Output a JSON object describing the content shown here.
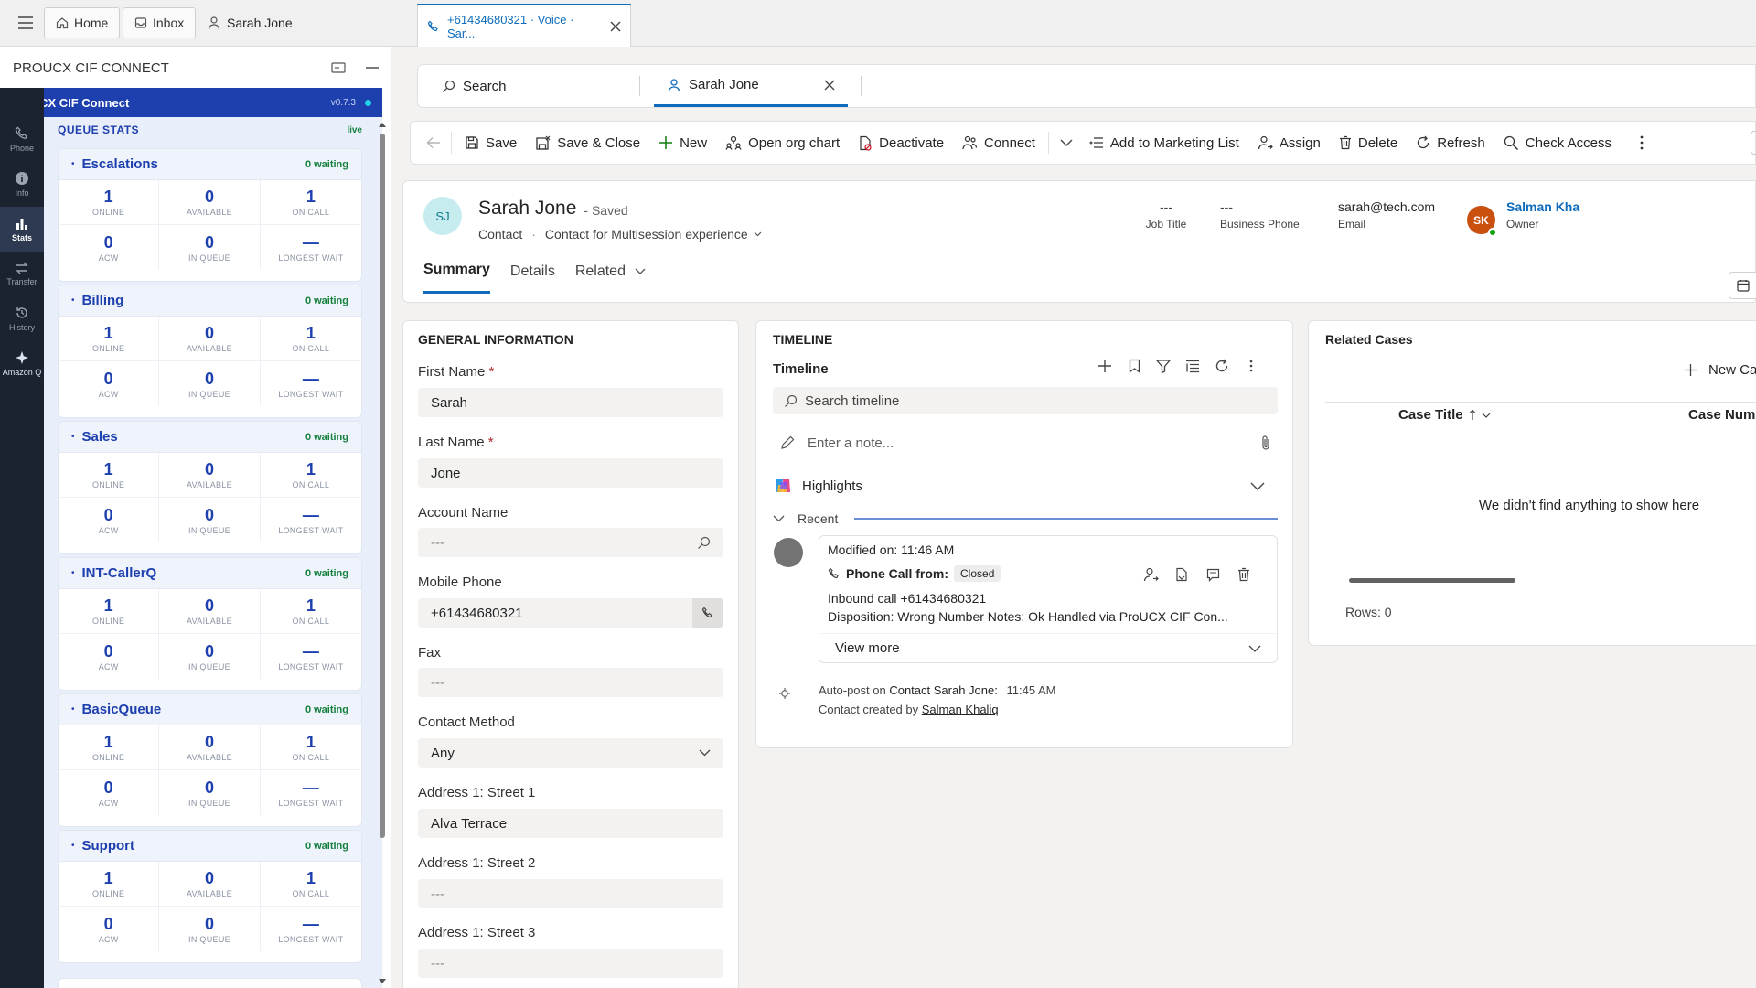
{
  "topbar": {
    "home_label": "Home",
    "inbox_label": "Inbox",
    "contact_tab_label": "Sarah Jone",
    "active_session_label": "+61434680321 · Voice · Sar..."
  },
  "cif": {
    "panel_title": "PROUCX CIF CONNECT",
    "bar_title": "ProUCX CIF Connect",
    "version": "v0.7.3",
    "section_title": "QUEUE STATS",
    "live_label": "live"
  },
  "nav": [
    {
      "label": "Phone",
      "icon": "phone-icon"
    },
    {
      "label": "Info",
      "icon": "info-icon"
    },
    {
      "label": "Stats",
      "icon": "stats-icon"
    },
    {
      "label": "Transfer",
      "icon": "transfer-icon"
    },
    {
      "label": "History",
      "icon": "history-icon"
    },
    {
      "label": "Amazon Q",
      "icon": "amazon-q-icon"
    }
  ],
  "stat_labels": {
    "online": "ONLINE",
    "available": "AVAILABLE",
    "on_call": "ON CALL",
    "acw": "ACW",
    "in_queue": "IN QUEUE",
    "longest_wait": "LONGEST WAIT"
  },
  "queues": [
    {
      "name": "Escalations",
      "waiting": "0 waiting",
      "online": "1",
      "available": "0",
      "on_call": "1",
      "acw": "0",
      "in_queue": "0",
      "longest_wait": "—"
    },
    {
      "name": "Billing",
      "waiting": "0 waiting",
      "online": "1",
      "available": "0",
      "on_call": "1",
      "acw": "0",
      "in_queue": "0",
      "longest_wait": "—"
    },
    {
      "name": "Sales",
      "waiting": "0 waiting",
      "online": "1",
      "available": "0",
      "on_call": "1",
      "acw": "0",
      "in_queue": "0",
      "longest_wait": "—"
    },
    {
      "name": "INT-CallerQ",
      "waiting": "0 waiting",
      "online": "1",
      "available": "0",
      "on_call": "1",
      "acw": "0",
      "in_queue": "0",
      "longest_wait": "—"
    },
    {
      "name": "BasicQueue",
      "waiting": "0 waiting",
      "online": "1",
      "available": "0",
      "on_call": "1",
      "acw": "0",
      "in_queue": "0",
      "longest_wait": "—"
    },
    {
      "name": "Support",
      "waiting": "0 waiting",
      "online": "1",
      "available": "0",
      "on_call": "1",
      "acw": "0",
      "in_queue": "0",
      "longest_wait": "—"
    }
  ],
  "session_tabs": {
    "search_label": "Search",
    "contact_label": "Sarah Jone"
  },
  "commands": {
    "save": "Save",
    "save_close": "Save & Close",
    "new": "New",
    "open_org_chart": "Open org chart",
    "deactivate": "Deactivate",
    "connect": "Connect",
    "add_marketing": "Add to Marketing List",
    "assign": "Assign",
    "delete": "Delete",
    "refresh": "Refresh",
    "check_access": "Check Access"
  },
  "record": {
    "initials": "SJ",
    "name": "Sarah Jone",
    "saved_status": "- Saved",
    "entity": "Contact",
    "form_name": "Contact for Multisession experience",
    "job_title_value": "---",
    "job_title_label": "Job Title",
    "business_phone_value": "---",
    "business_phone_label": "Business Phone",
    "email_value": "sarah@tech.com",
    "email_label": "Email",
    "owner_initials": "SK",
    "owner_name": "Salman Kha",
    "owner_label": "Owner",
    "tabs": {
      "summary": "Summary",
      "details": "Details",
      "related": "Related"
    }
  },
  "general": {
    "title": "GENERAL INFORMATION",
    "first_name_label": "First Name",
    "first_name_value": "Sarah",
    "last_name_label": "Last Name",
    "last_name_value": "Jone",
    "account_label": "Account Name",
    "account_value": "---",
    "mobile_label": "Mobile Phone",
    "mobile_value": "+61434680321",
    "fax_label": "Fax",
    "fax_value": "---",
    "contact_method_label": "Contact Method",
    "contact_method_value": "Any",
    "street1_label": "Address 1: Street 1",
    "street1_value": "Alva Terrace",
    "street2_label": "Address 1: Street 2",
    "street2_value": "---",
    "street3_label": "Address 1: Street 3",
    "street3_value": "---",
    "required_mark": "*"
  },
  "timeline": {
    "section_title": "TIMELINE",
    "title": "Timeline",
    "search_placeholder": "Search timeline",
    "note_placeholder": "Enter a note...",
    "highlights_label": "Highlights",
    "recent_label": "Recent",
    "activity": {
      "modified": "Modified on: 11:46 AM",
      "type": "Phone Call from:",
      "status": "Closed",
      "line1": "Inbound call +61434680321",
      "line2": "Disposition: Wrong Number Notes: Ok Handled via ProUCX CIF Con...",
      "view_more": "View more"
    },
    "autopost": {
      "prefix": "Auto-post on ",
      "subject": "Contact Sarah Jone:",
      "time": "11:45 AM",
      "created_prefix": "Contact created by ",
      "created_by": "Salman Khaliq"
    }
  },
  "related_cases": {
    "title": "Related Cases",
    "new_label": "New Ca",
    "col_case_title": "Case Title",
    "col_case_number": "Case Numb",
    "empty_message": "We didn't find anything to show here",
    "rows": "Rows: 0"
  },
  "colors": {
    "brand_blue": "#1e40af",
    "dynamics_blue": "#0f6cbd",
    "waiting_green": "#15803d",
    "avatar_teal": "#c7ecf0",
    "owner_orange": "#ca5010"
  }
}
